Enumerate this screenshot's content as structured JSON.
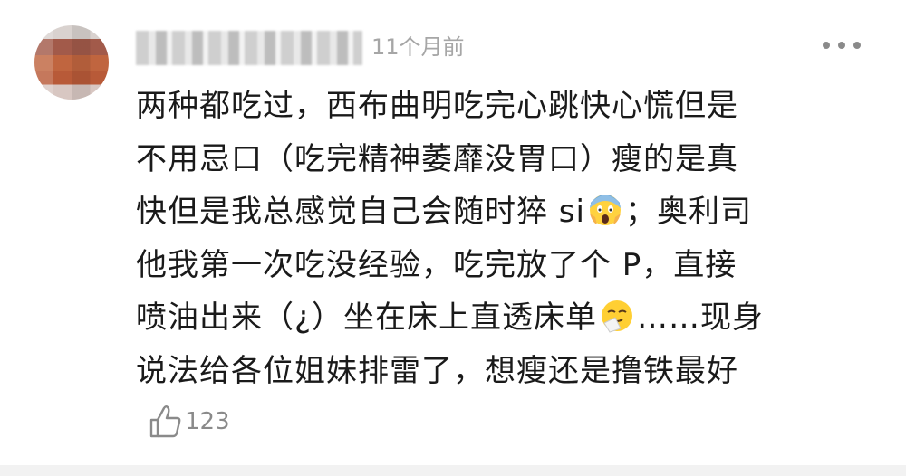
{
  "comment": {
    "time_ago": "11个月前",
    "lines": [
      "两种都吃过，西布曲明吃完心跳快心慌但是",
      "不用忌口（吃完精神萎靡没胃口）瘦的是真",
      "快但是我总感觉自己会随时猝 si",
      "；奥利司",
      "他我第一次吃没经验，吃完放了个 P，直接",
      "喷油出来（¿）坐在床上直透床单",
      "……现身",
      "说法给各位姐妹排雷了，想瘦还是撸铁最好"
    ],
    "emoji_1": "screaming-face-emoji",
    "emoji_2": "sneezing-face-emoji",
    "like_count": "123"
  },
  "colors": {
    "text": "#1a1a1a",
    "meta": "#a6a6a6",
    "icon": "#8a8a8a"
  },
  "icons": [
    "more-icon",
    "thumbs-up-icon"
  ]
}
